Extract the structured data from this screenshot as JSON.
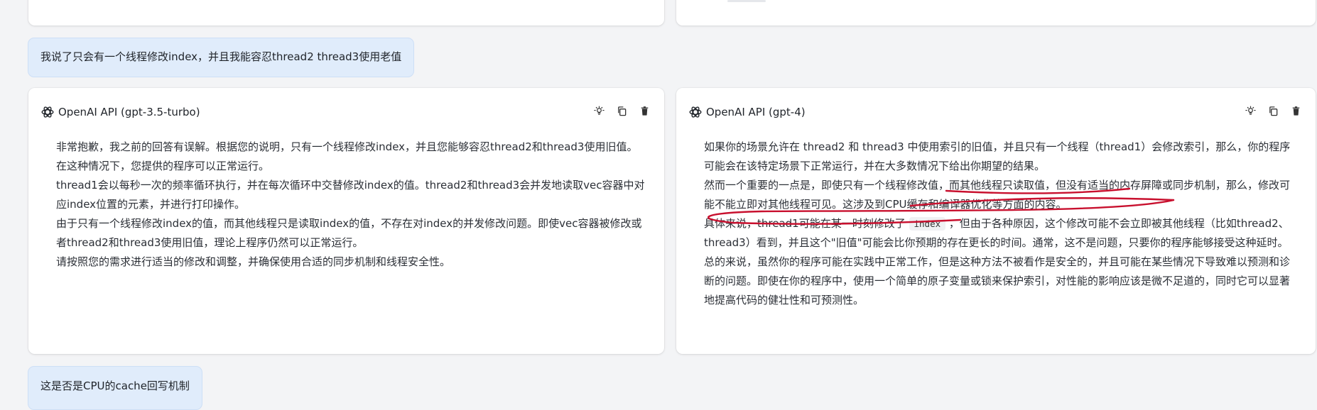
{
  "chat": {
    "user_message_1": "我说了只会有一个线程修改index，并且我能容忍thread2 thread3使用老值",
    "user_message_2": "这是否是CPU的cache回写机制"
  },
  "left_panel": {
    "model": "OpenAI API (gpt-3.5-turbo)",
    "paragraphs": [
      "非常抱歉，我之前的回答有误解。根据您的说明，只有一个线程修改index，并且您能够容忍thread2和thread3使用旧值。在这种情况下，您提供的程序可以正常运行。",
      "thread1会以每秒一次的频率循环执行，并在每次循环中交替修改index的值。thread2和thread3会并发地读取vec容器中对应index位置的元素，并进行打印操作。",
      "由于只有一个线程修改index的值，而其他线程只是读取index的值，不存在对index的并发修改问题。即使vec容器被修改或者thread2和thread3使用旧值，理论上程序仍然可以正常运行。",
      "请按照您的需求进行适当的修改和调整，并确保使用合适的同步机制和线程安全性。"
    ]
  },
  "right_panel": {
    "model": "OpenAI API (gpt-4)",
    "paragraphs": [
      "如果你的场景允许在 thread2 和 thread3 中使用索引的旧值，并且只有一个线程（thread1）会修改索引，那么，你的程序可能会在该特定场景下正常运行，并在大多数情况下给出你期望的结果。",
      "然而一个重要的一点是，即使只有一个线程修改值，而其他线程只读取值，但没有适当的内存屏障或同步机制，那么，修改可能不能立即对其他线程可见。这涉及到CPU缓存和编译器优化等方面的内容。"
    ],
    "p3_before_code": "具体来说，thread1可能在某一时刻修改了",
    "p3_code": "index",
    "p3_after_code": "，但由于各种原因，这个修改可能不会立即被其他线程（比如thread2、thread3）看到，并且这个\"旧值\"可能会比你预期的存在更长的时间。通常，这不是问题，只要你的程序能够接受这种延时。",
    "p4": "总的来说，虽然你的程序可能在实践中正常工作，但是这种方法不被看作是安全的，并且可能在某些情况下导致难以预测和诊断的问题。即使在你的程序中，使用一个简单的原子变量或锁来保护索引，对性能的影响应该是微不足道的，同时它可以显著地提高代码的健壮性和可预测性。"
  },
  "icons": [
    "openai-logo-icon",
    "lightbulb-icon",
    "copy-icon",
    "trash-icon"
  ],
  "colors": {
    "annotation": "#c8102e",
    "user_bubble": "#e0ecfb",
    "page_bg": "#f3f4f6"
  }
}
